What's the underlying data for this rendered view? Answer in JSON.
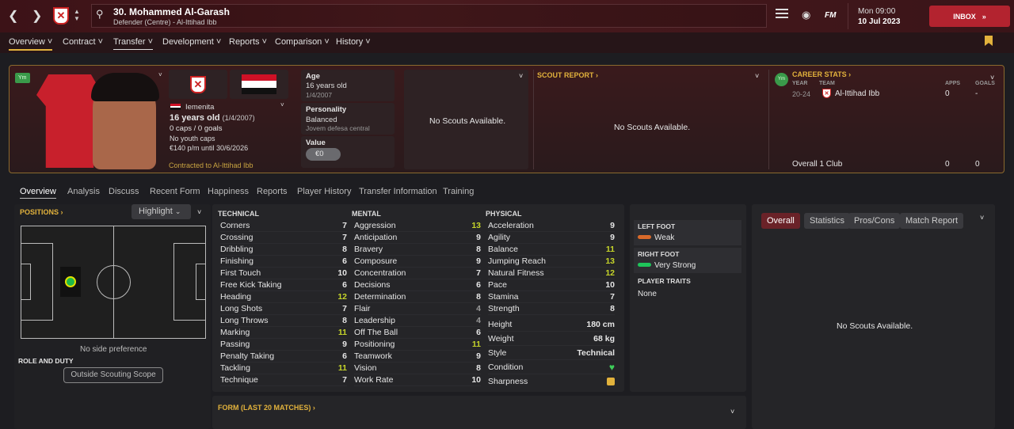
{
  "topbar": {
    "player_title": "30. Mohammed Al-Garash",
    "player_subtitle": "Defender (Centre) - Al-Ittihad Ibb",
    "club_crest": "shield-x-icon",
    "time": "Mon 09:00",
    "date": "10 Jul 2023",
    "inbox": "INBOX",
    "fm": "FM"
  },
  "menu": [
    "Overview",
    "Contract",
    "Transfer",
    "Development",
    "Reports",
    "Comparison",
    "History"
  ],
  "profile": {
    "badge": "Ym",
    "nationality": "Iemenita",
    "age_line": "16 years old",
    "dob": "(1/4/2007)",
    "caps": "0 caps / 0 goals",
    "youth": "No youth caps",
    "wage": "€140 p/m until 30/6/2026",
    "contract": "Contracted to Al-Ittihad Ibb"
  },
  "info": {
    "age_label": "Age",
    "age_value": "16 years old",
    "age_dob": "1/4/2007",
    "personality_label": "Personality",
    "personality_value": "Balanced",
    "personality_sub": "Jovem defesa central",
    "value_label": "Value",
    "value": "€0"
  },
  "scouts": {
    "box1": "No Scouts Available.",
    "report_title": "SCOUT REPORT",
    "box2": "No Scouts Available."
  },
  "career": {
    "title": "CAREER STATS",
    "col_year": "YEAR",
    "col_team": "TEAM",
    "col_apps": "APPS",
    "col_goals": "GOALS",
    "year": "20-24",
    "team": "Al-Ittihad Ibb",
    "apps": "0",
    "goals": "-",
    "overall": "Overall 1 Club",
    "overall_apps": "0",
    "overall_goals": "0",
    "badge": "Ym"
  },
  "tabs": [
    "Overview",
    "Analysis",
    "Discuss",
    "Recent Form",
    "Happiness",
    "Reports",
    "Player History",
    "Transfer Information",
    "Training"
  ],
  "positions": {
    "title": "POSITIONS",
    "highlight": "Highlight",
    "side": "No side preference",
    "role_title": "ROLE AND DUTY",
    "scope": "Outside Scouting Scope"
  },
  "technical": {
    "title": "TECHNICAL",
    "rows": [
      [
        "Corners",
        "7"
      ],
      [
        "Crossing",
        "7"
      ],
      [
        "Dribbling",
        "8"
      ],
      [
        "Finishing",
        "6"
      ],
      [
        "First Touch",
        "10"
      ],
      [
        "Free Kick Taking",
        "6"
      ],
      [
        "Heading",
        "12"
      ],
      [
        "Long Shots",
        "7"
      ],
      [
        "Long Throws",
        "8"
      ],
      [
        "Marking",
        "11"
      ],
      [
        "Passing",
        "9"
      ],
      [
        "Penalty Taking",
        "6"
      ],
      [
        "Tackling",
        "11"
      ],
      [
        "Technique",
        "7"
      ]
    ]
  },
  "mental": {
    "title": "MENTAL",
    "rows": [
      [
        "Aggression",
        "13"
      ],
      [
        "Anticipation",
        "9"
      ],
      [
        "Bravery",
        "8"
      ],
      [
        "Composure",
        "9"
      ],
      [
        "Concentration",
        "7"
      ],
      [
        "Decisions",
        "6"
      ],
      [
        "Determination",
        "8"
      ],
      [
        "Flair",
        "4"
      ],
      [
        "Leadership",
        "4"
      ],
      [
        "Off The Ball",
        "6"
      ],
      [
        "Positioning",
        "11"
      ],
      [
        "Teamwork",
        "9"
      ],
      [
        "Vision",
        "8"
      ],
      [
        "Work Rate",
        "10"
      ]
    ]
  },
  "physical": {
    "title": "PHYSICAL",
    "rows": [
      [
        "Acceleration",
        "9"
      ],
      [
        "Agility",
        "9"
      ],
      [
        "Balance",
        "11"
      ],
      [
        "Jumping Reach",
        "13"
      ],
      [
        "Natural Fitness",
        "12"
      ],
      [
        "Pace",
        "10"
      ],
      [
        "Stamina",
        "7"
      ],
      [
        "Strength",
        "8"
      ]
    ],
    "height_label": "Height",
    "height": "180 cm",
    "weight_label": "Weight",
    "weight": "68 kg",
    "style_label": "Style",
    "style": "Technical",
    "condition_label": "Condition",
    "sharpness_label": "Sharpness"
  },
  "feet": {
    "left_title": "LEFT FOOT",
    "left": "Weak",
    "right_title": "RIGHT FOOT",
    "right": "Very Strong",
    "traits_title": "PLAYER TRAITS",
    "traits": "None"
  },
  "form": {
    "title": "FORM (LAST 20 MATCHES)"
  },
  "right_panel": {
    "tabs": [
      "Overall",
      "Statistics",
      "Pros/Cons",
      "Match Report"
    ],
    "empty": "No Scouts Available."
  },
  "colors": {
    "accent": "#e2b23c",
    "high": "#c6d52a",
    "green": "#3ecf5a"
  }
}
